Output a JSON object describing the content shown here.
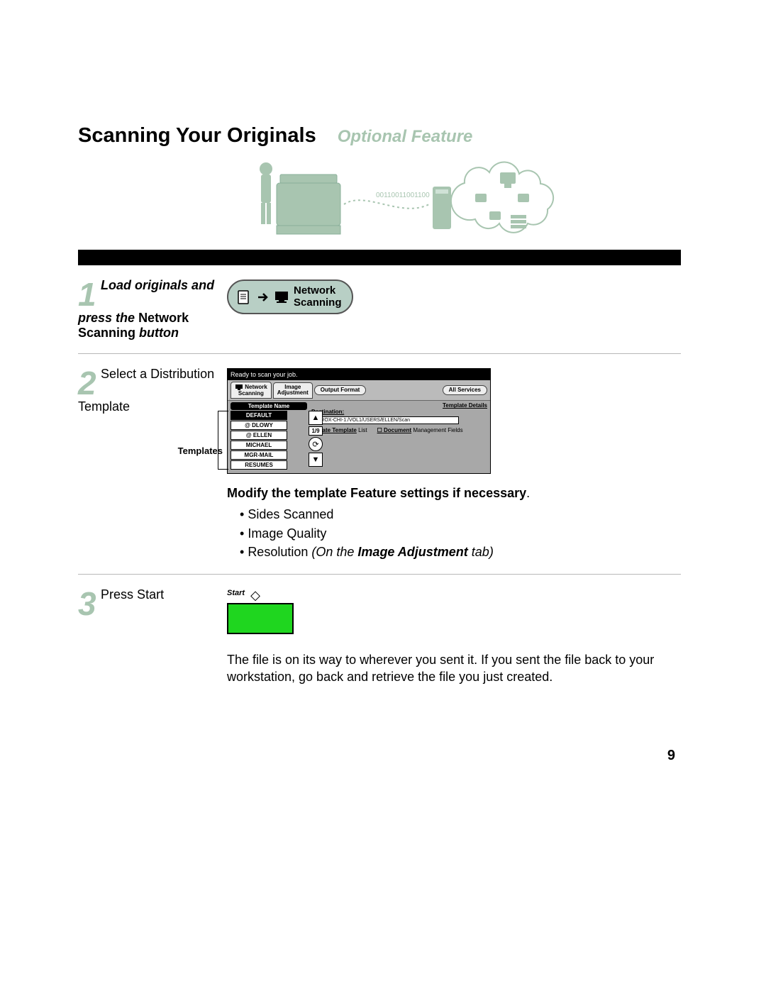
{
  "title": {
    "main": "Scanning Your Originals",
    "sub": "Optional Feature"
  },
  "step1": {
    "number": "1",
    "line1": "Load originals and press the",
    "line2": "Network Scanning",
    "line3": "button",
    "button": {
      "line1": "Network",
      "line2": "Scanning"
    }
  },
  "step2": {
    "number": "2",
    "text": "Select a Distribution Template",
    "templates_label": "Templates",
    "screenshot": {
      "status": "Ready to scan your job.",
      "tabs": {
        "network_scanning": "Network\nScanning",
        "image_adjustment": "Image\nAdjustment",
        "output_format": "Output Format",
        "all_services": "All Services"
      },
      "col_head": "Template Name",
      "items": [
        "DEFAULT",
        "@ DLOWY",
        "@ ELLEN",
        "MICHAEL",
        "MGR-MAIL",
        "RESUMES"
      ],
      "pager": "1/9",
      "details_head": "Template Details",
      "destination_label": "Destination:",
      "destination_value": "XEROX-CHI-1:/VOL1/USERS/ELLEN/Scan",
      "update_template": "Update Template",
      "update_template_sub": "List",
      "doc_mgmt": "Document",
      "doc_mgmt_sub": "Management Fields"
    },
    "modify": {
      "heading": "Modify the template Feature settings if necessary",
      "dot": ".",
      "items": [
        "Sides Scanned",
        "Image Quality"
      ],
      "item3_prefix": "Resolution ",
      "item3_italic": "On the ",
      "item3_bold": "Image Adjustment",
      "item3_suffix": " tab"
    }
  },
  "step3": {
    "number": "3",
    "text": "Press Start",
    "start_label": "Start",
    "body": "The file is on its way to wherever you sent it. If you sent the file back to your workstation, go back and retrieve the file you just created."
  },
  "page_number": "9"
}
